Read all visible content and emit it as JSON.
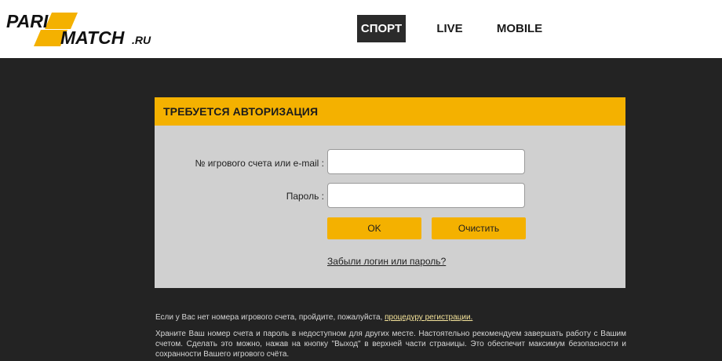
{
  "logo": {
    "line1": "PARI",
    "line2": "MATCH",
    "suffix": ".RU",
    "accent": "#f4b100"
  },
  "nav": {
    "items": [
      {
        "label": "СПОРТ",
        "active": true
      },
      {
        "label": "LIVE",
        "active": false
      },
      {
        "label": "MOBILE",
        "active": false
      }
    ]
  },
  "auth": {
    "title": "ТРЕБУЕТСЯ АВТОРИЗАЦИЯ",
    "account_label": "№ игрового счета или e-mail :",
    "account_value": "",
    "password_label": "Пароль :",
    "password_value": "",
    "ok_label": "OK",
    "clear_label": "Очистить",
    "forgot_label": "Забыли логин или пароль?"
  },
  "info": {
    "line1_text": "Если у Вас нет номера игрового счета, пройдите, пожалуйста, ",
    "line1_link": "процедуру регистрации.",
    "line2": "Храните Ваш номер счета и пароль в недоступном для других месте. Настоятельно рекомендуем завершать работу с Вашим счетом. Сделать это можно, нажав на кнопку \"Выход\" в верхней части страницы. Это обеспечит максимум безопасности и сохранности Вашего игрового счёта."
  },
  "colors": {
    "accent": "#f4b100",
    "background": "#232323",
    "panel": "#d0d0d0"
  }
}
